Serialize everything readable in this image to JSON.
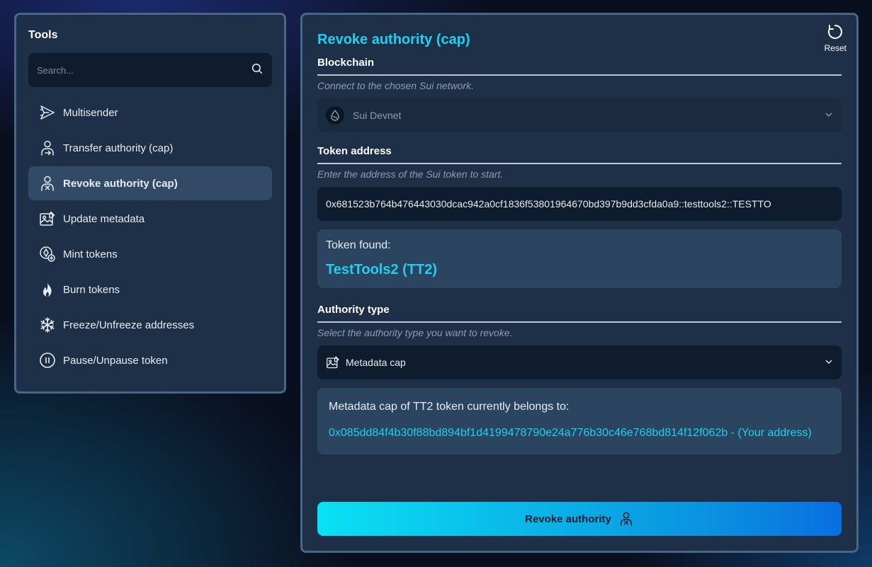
{
  "sidebar": {
    "title": "Tools",
    "search_placeholder": "Search...",
    "items": [
      {
        "label": "Multisender",
        "icon": "send-icon"
      },
      {
        "label": "Transfer authority (cap)",
        "icon": "user-transfer-icon"
      },
      {
        "label": "Revoke authority (cap)",
        "icon": "user-revoke-icon",
        "active": true
      },
      {
        "label": "Update metadata",
        "icon": "image-edit-icon"
      },
      {
        "label": "Mint tokens",
        "icon": "coin-plus-icon"
      },
      {
        "label": "Burn tokens",
        "icon": "flame-icon"
      },
      {
        "label": "Freeze/Unfreeze addresses",
        "icon": "snowflake-icon"
      },
      {
        "label": "Pause/Unpause token",
        "icon": "pause-icon"
      }
    ]
  },
  "main": {
    "title": "Revoke authority (cap)",
    "reset_label": "Reset",
    "blockchain": {
      "label": "Blockchain",
      "hint": "Connect to the chosen Sui network.",
      "selected": "Sui Devnet"
    },
    "token_address": {
      "label": "Token address",
      "hint": "Enter the address of the Sui token to start.",
      "value": "0x681523b764b476443030dcac942a0cf1836f53801964670bd397b9dd3cfda0a9::testtools2::TESTTO"
    },
    "token_found": {
      "label": "Token found:",
      "name": "TestTools2 (TT2)"
    },
    "authority_type": {
      "label": "Authority type",
      "hint": "Select the authority type you want to revoke.",
      "selected": "Metadata cap"
    },
    "owner": {
      "label": "Metadata cap of TT2 token currently belongs to:",
      "address": "0x085dd84f4b30f88bd894bf1d4199478790e24a776b30c46e768bd814f12f062b - (Your address)"
    },
    "revoke_button_label": "Revoke authority"
  },
  "colors": {
    "accent": "#1fd0f0",
    "panel_bg": "#1e3047",
    "border": "#4a6686"
  }
}
